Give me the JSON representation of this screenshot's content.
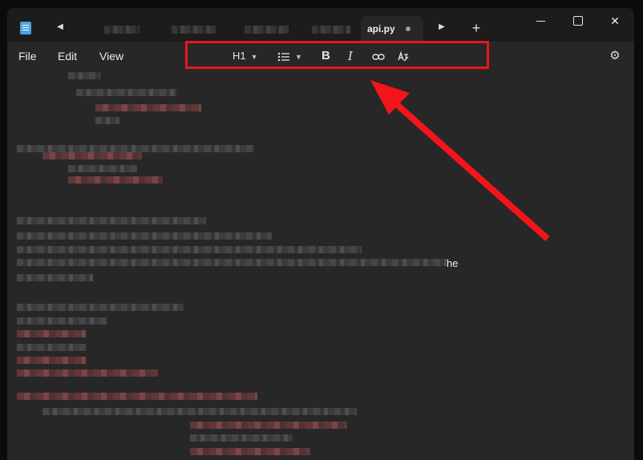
{
  "tabs": {
    "active_label": "api.py",
    "new_tab_label": "+"
  },
  "menu": {
    "file": "File",
    "edit": "Edit",
    "view": "View"
  },
  "toolbar": {
    "heading_label": "H1",
    "heading_icon": "heading-dropdown",
    "list_icon": "bulleted-list",
    "bold_label": "B",
    "italic_label": "I",
    "link_icon": "link",
    "clear_format_icon": "clear-formatting",
    "highlight_color": "#e8161b"
  },
  "settings_icon": "gear",
  "editor": {
    "visible_fragment": "he"
  },
  "annotation": {
    "arrow_color": "#f4141b"
  }
}
